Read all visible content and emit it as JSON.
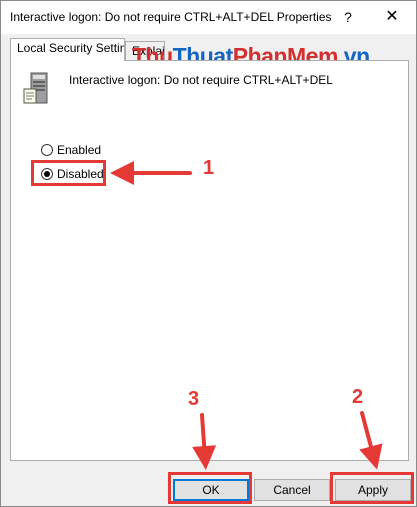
{
  "window": {
    "title": "Interactive logon: Do not require CTRL+ALT+DEL Properties",
    "help_label": "?",
    "close_label": "✕"
  },
  "tabs": [
    {
      "label": "Local Security Setting",
      "active": true
    },
    {
      "label": "Explain",
      "active": false
    }
  ],
  "policy": {
    "icon": "server-policy-icon",
    "name": "Interactive logon: Do not require CTRL+ALT+DEL"
  },
  "options": {
    "enabled_label": "Enabled",
    "disabled_label": "Disabled",
    "selected": "Disabled"
  },
  "buttons": {
    "ok": "OK",
    "cancel": "Cancel",
    "apply": "Apply"
  },
  "annotations": {
    "step1": "1",
    "step2": "2",
    "step3": "3",
    "color": "#e53935"
  },
  "watermark": {
    "part1": "Thu",
    "part2": "Thuat",
    "part3": "PhanMem",
    "part4": ".vn"
  }
}
